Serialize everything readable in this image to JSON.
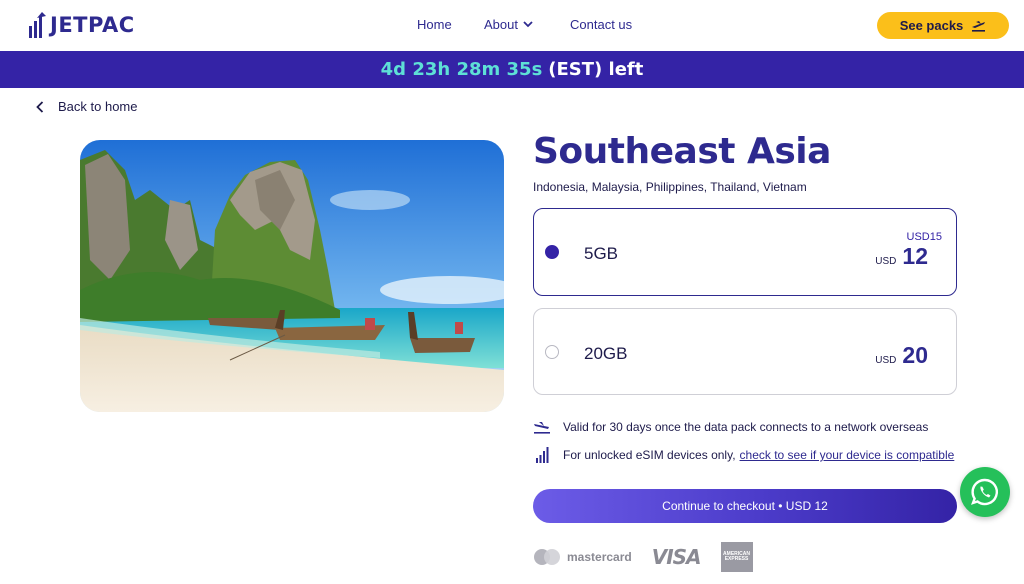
{
  "header": {
    "logo_text": "JETPAC",
    "nav": {
      "home": "Home",
      "about": "About",
      "contact": "Contact us"
    },
    "cta": "See packs"
  },
  "banner": {
    "countdown": "4d 23h 28m 35s",
    "suffix": "(EST) left"
  },
  "back_link": "Back to home",
  "product": {
    "title": "Southeast Asia",
    "countries": "Indonesia, Malaysia, Philippines, Thailand, Vietnam",
    "packs": [
      {
        "label": "5GB",
        "old_price": "USD15",
        "currency": "USD",
        "price": "12",
        "selected": true
      },
      {
        "label": "20GB",
        "currency": "USD",
        "price": "20",
        "selected": false
      }
    ],
    "validity": "Valid for 30 days once the data pack connects to a network overseas",
    "devices_prefix": "For unlocked eSIM devices only,",
    "devices_link": "check to see if your device is compatible",
    "checkout": "Continue to checkout • USD 12"
  },
  "payments": {
    "mastercard": "mastercard",
    "visa": "VISA",
    "amex_line1": "AMERICAN",
    "amex_line2": "EXPRESS"
  },
  "colors": {
    "brand": "#2e2a8f",
    "banner_bg": "#3423a6",
    "countdown": "#5ee0d6",
    "cta": "#fbbf1a",
    "whatsapp": "#25c05a"
  },
  "icons": {
    "back": "chevron-left-icon",
    "about": "chevron-down-icon",
    "cta": "plane-icon",
    "validity": "plane-landing-icon",
    "devices": "signal-bars-icon",
    "chat": "whatsapp-icon"
  }
}
